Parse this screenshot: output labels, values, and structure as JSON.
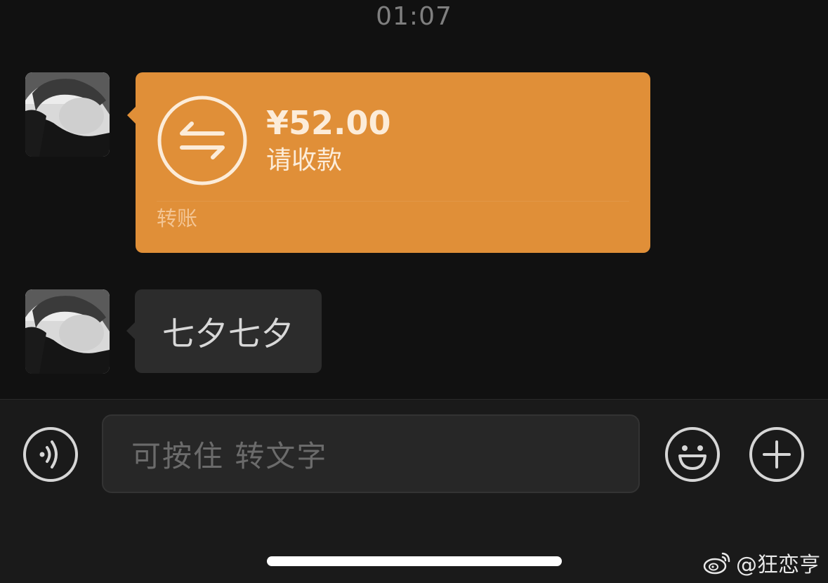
{
  "timestamp": "01:07",
  "messages": [
    {
      "type": "transfer",
      "amount": "¥52.00",
      "status": "请收款",
      "footer": "转账",
      "color": "#e08f38"
    },
    {
      "type": "text",
      "text": "七夕七夕"
    }
  ],
  "input_bar": {
    "placeholder": "可按住 转文字",
    "icons": [
      "voice-icon",
      "emoji-icon",
      "plus-icon"
    ]
  },
  "watermark": "@狂恋亨",
  "colors": {
    "background": "#111111",
    "transfer_bubble": "#e08f38",
    "text_bubble": "#2c2c2c"
  }
}
